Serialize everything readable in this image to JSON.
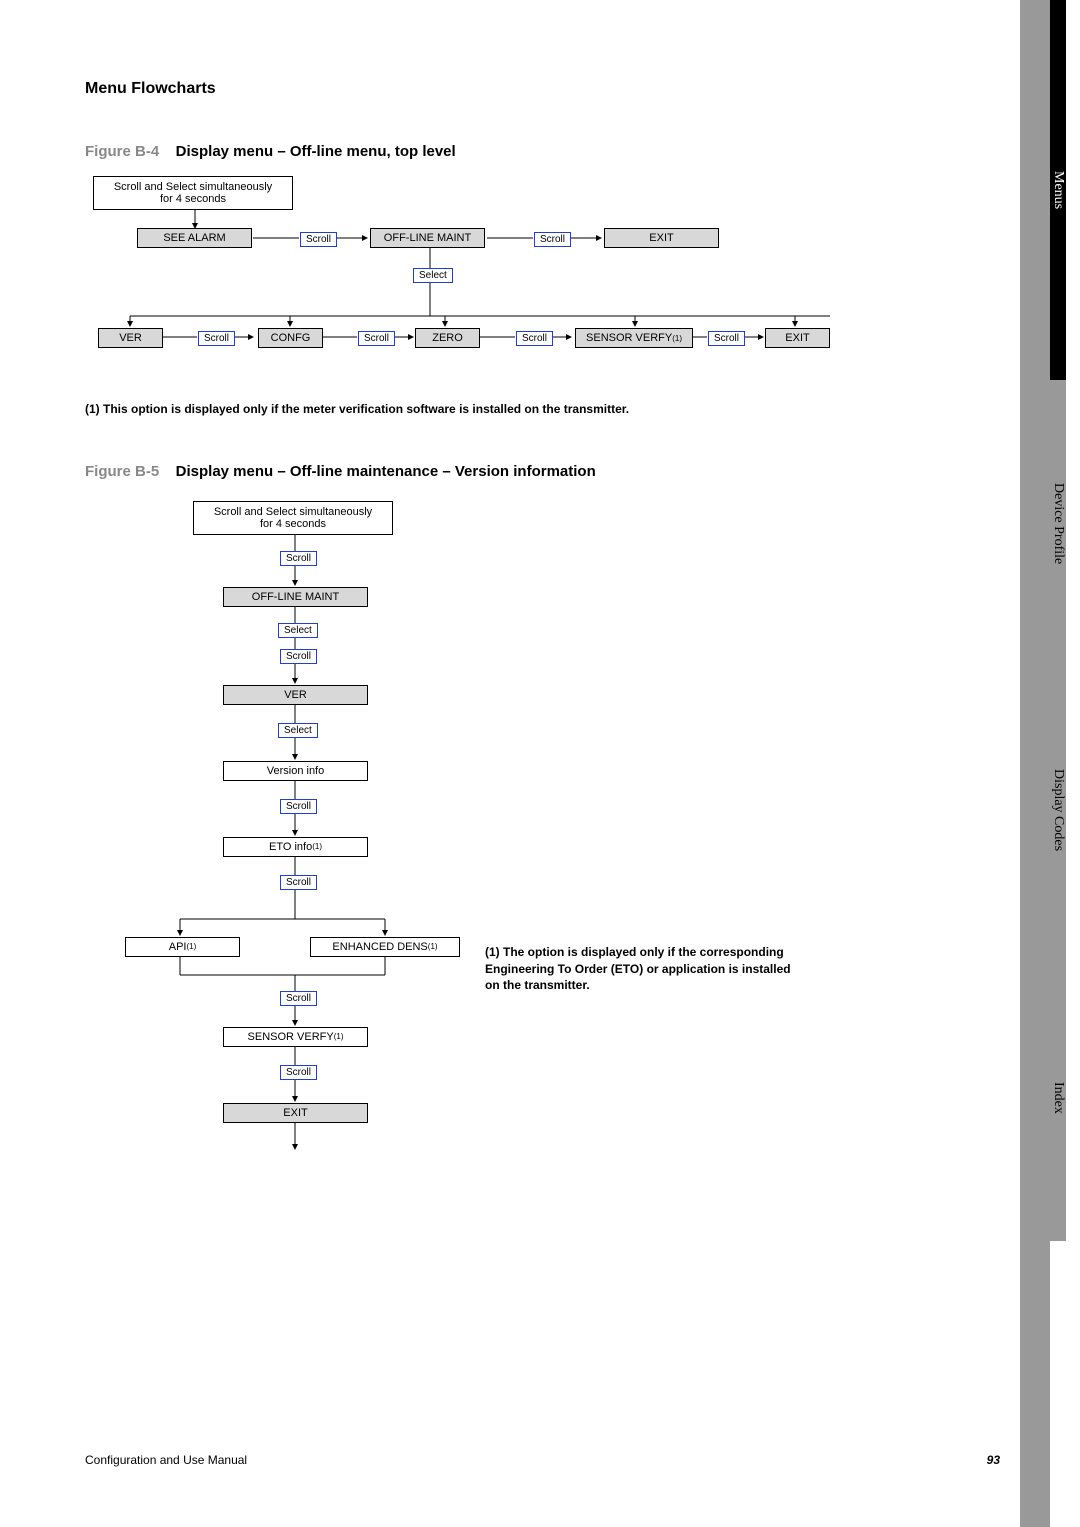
{
  "header": {
    "section_title": "Menu Flowcharts"
  },
  "figure_b4": {
    "label": "Figure B-4",
    "title": "Display menu – Off-line menu, top level",
    "boxes": {
      "scroll_select": "Scroll and Select simultaneously\nfor 4 seconds",
      "see_alarm": "SEE ALARM",
      "offline_maint": "OFF-LINE MAINT",
      "exit": "EXIT",
      "ver": "VER",
      "confg": "CONFG",
      "zero": "ZERO",
      "sensor_verfy": "SENSOR VERFY",
      "exit2": "EXIT"
    },
    "labels": {
      "scroll": "Scroll",
      "select": "Select"
    },
    "footnote": "(1) This option is displayed only if the meter verification software is installed on the transmitter."
  },
  "figure_b5": {
    "label": "Figure B-5",
    "title": "Display menu – Off-line maintenance – Version information",
    "boxes": {
      "scroll_select": "Scroll and Select simultaneously\nfor 4 seconds",
      "offline_maint": "OFF-LINE MAINT",
      "ver": "VER",
      "version_info": "Version info",
      "eto_info": "ETO info",
      "api": "API",
      "enhanced_dens": "ENHANCED DENS",
      "sensor_verfy": "SENSOR VERFY",
      "exit": "EXIT"
    },
    "labels": {
      "scroll": "Scroll",
      "select": "Select"
    },
    "footnote": "(1) The option is displayed only if the corresponding Engineering To Order (ETO) or application is installed on the transmitter."
  },
  "sidebar": {
    "tabs": [
      "Menus",
      "Device Profile",
      "Display Codes",
      "Index"
    ]
  },
  "footer": {
    "left": "Configuration and Use Manual",
    "right": "93"
  }
}
